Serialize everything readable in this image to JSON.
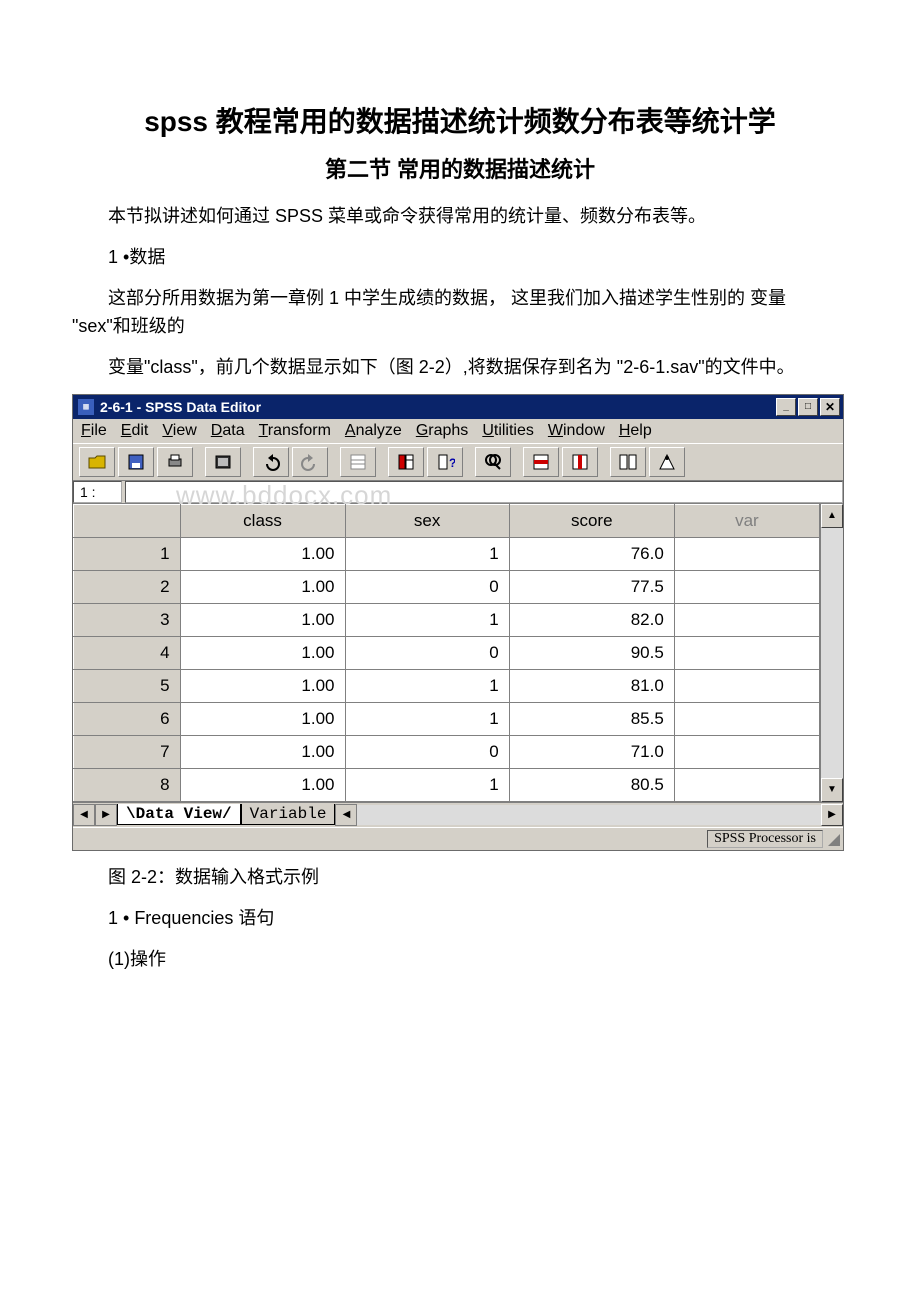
{
  "doc": {
    "h1": "spss 教程常用的数据描述统计频数分布表等统计学",
    "h2": "第二节 常用的数据描述统计",
    "p1": "本节拟讲述如何通过 SPSS 菜单或命令获得常用的统计量、频数分布表等。",
    "p2": "1 •数据",
    "p3": "这部分所用数据为第一章例 1 中学生成绩的数据， 这里我们加入描述学生性别的 变量 \"sex\"和班级的",
    "p4": "变量\"class\"，前几个数据显示如下（图 2-2）,将数据保存到名为 \"2-6-1.sav\"的文件中。",
    "caption": "图 2-2：数据输入格式示例",
    "p5": "1 • Frequencies 语句",
    "p6": "(1)操作"
  },
  "spss": {
    "title": "2-6-1 - SPSS Data Editor",
    "menus": [
      "File",
      "Edit",
      "View",
      "Data",
      "Transform",
      "Analyze",
      "Graphs",
      "Utilities",
      "Window",
      "Help"
    ],
    "cell_label": "1  :",
    "watermark": "www.bddocx.com",
    "columns": [
      "class",
      "sex",
      "score",
      "var"
    ],
    "rows": [
      {
        "n": "1",
        "class": "1.00",
        "sex": "1",
        "score": "76.0"
      },
      {
        "n": "2",
        "class": "1.00",
        "sex": "0",
        "score": "77.5"
      },
      {
        "n": "3",
        "class": "1.00",
        "sex": "1",
        "score": "82.0"
      },
      {
        "n": "4",
        "class": "1.00",
        "sex": "0",
        "score": "90.5"
      },
      {
        "n": "5",
        "class": "1.00",
        "sex": "1",
        "score": "81.0"
      },
      {
        "n": "6",
        "class": "1.00",
        "sex": "1",
        "score": "85.5"
      },
      {
        "n": "7",
        "class": "1.00",
        "sex": "0",
        "score": "71.0"
      },
      {
        "n": "8",
        "class": "1.00",
        "sex": "1",
        "score": "80.5"
      }
    ],
    "tab_active": "Data View",
    "tab_inactive": "Variable",
    "status": "SPSS Processor  is"
  }
}
